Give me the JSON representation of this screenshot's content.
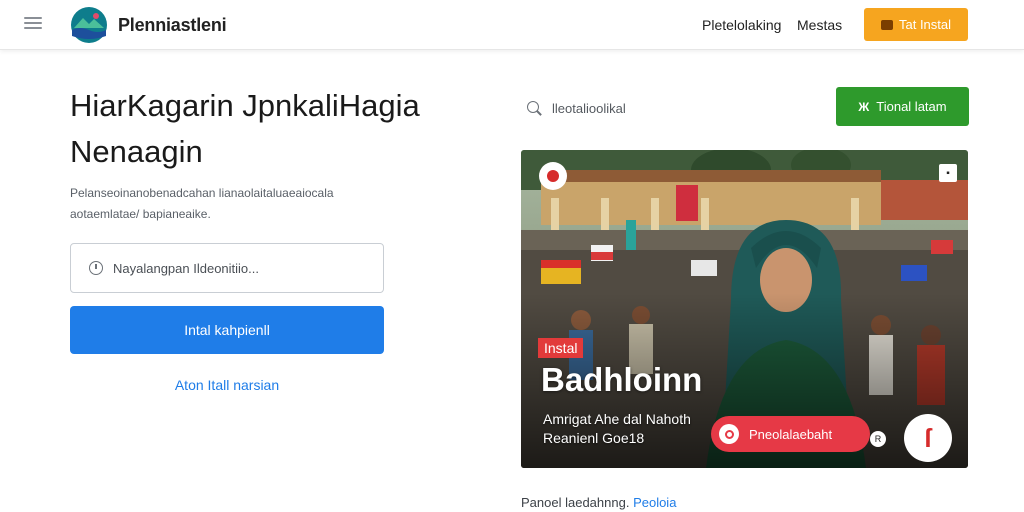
{
  "header": {
    "brand": "Plenniastleni",
    "nav": [
      "Pletelolaking",
      "Mestas"
    ],
    "install_label": "Tat Instal"
  },
  "hero": {
    "title": "HiarKagarin JpnkaliHagia Nenaagin",
    "description": "Pelanseoinanobenadcahan lianaolaitaluaeaiocala aotaemlatae/ bapianeaike.",
    "email_placeholder": "Nayalangpan Ildeonitiio...",
    "primary_label": "Intal kahpienll",
    "secondary_label": "Aton Itall narsian"
  },
  "search": {
    "placeholder": "lleotalioolikal"
  },
  "green_button": {
    "icon": "Ж",
    "label": "Tional latam"
  },
  "card": {
    "badge": "Instal",
    "title": "Badhloinn",
    "subtitle_line1": "Amrigat Ahe dal Nahoth",
    "subtitle_line2": "Reanienl Goe18",
    "pill_label": "Pneolalaebaht",
    "small_badge": "R",
    "round_glyph": "ſ"
  },
  "footer": {
    "text": "Panoel laedahnng.",
    "link": "Peoloia"
  },
  "colors": {
    "accent_orange": "#f6a51f",
    "primary_blue": "#1f7de8",
    "green": "#2e9a2c",
    "red": "#e63946"
  }
}
